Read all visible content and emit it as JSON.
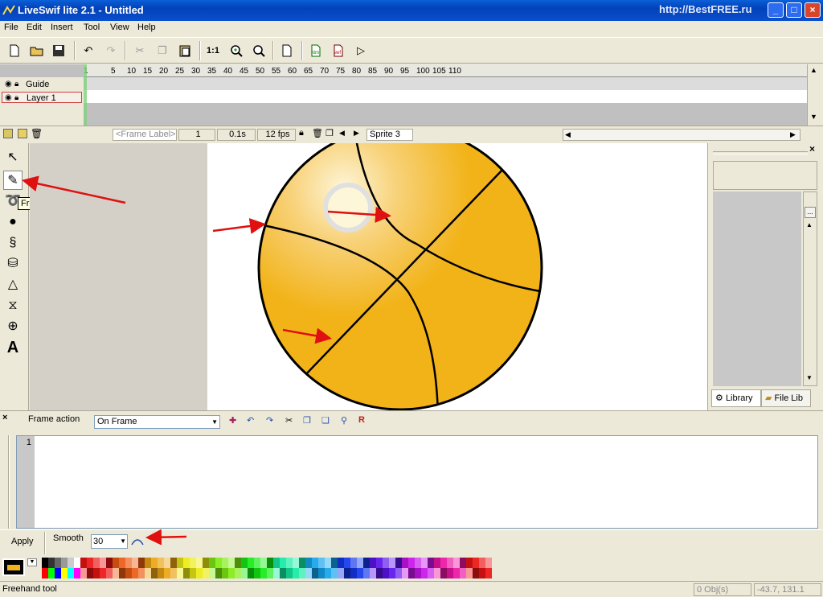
{
  "window": {
    "title": "LiveSwif lite 2.1  - Untitled",
    "watermark": "http://BestFREE.ru",
    "buttons": [
      "_",
      "□",
      "×"
    ]
  },
  "menu": [
    "File",
    "Edit",
    "Insert",
    "Tool",
    "View",
    "Help"
  ],
  "toolbar": {
    "icons": [
      "new-icon",
      "open-icon",
      "save-icon",
      "undo-icon",
      "redo-icon",
      "cut-icon",
      "copy-icon",
      "paste-icon",
      "zoom-1-1",
      "zoom-in-icon",
      "zoom-fit-icon",
      "page-icon",
      "export-html-icon",
      "export-swf-icon",
      "play-icon"
    ],
    "zoom_label": "1:1"
  },
  "timeline": {
    "ticks": [
      "1",
      "5",
      "10",
      "15",
      "20",
      "25",
      "30",
      "35",
      "40",
      "45",
      "50",
      "55",
      "60",
      "65",
      "70",
      "75",
      "80",
      "85",
      "90",
      "95",
      "100",
      "105",
      "110"
    ],
    "layers": [
      {
        "name": "Guide"
      },
      {
        "name": "Layer 1"
      }
    ],
    "frame_label_placeholder": "<Frame Label>",
    "frame_number": "1",
    "time": "0.1s",
    "fps": "12 fps",
    "sprite_tab": "Sprite 3"
  },
  "tools": {
    "items": [
      "arrow-tool",
      "freehand-tool",
      "lasso-tool",
      "oval-tool",
      "curve-tool",
      "paint-bucket-tool",
      "transform-tool",
      "envelope-tool",
      "zoom-tool",
      "text-tool"
    ],
    "text_tool_glyph": "A",
    "tooltip": "Freehand tool"
  },
  "stage": {
    "ball_colors": {
      "fill": "#f2b318",
      "highlight": "#fdf6d8",
      "stroke": "#000000"
    }
  },
  "library": {
    "tabs": [
      "Library",
      "File Lib"
    ],
    "more_button": "..."
  },
  "action": {
    "title": "Frame action",
    "event": "On Frame",
    "line_number": "1"
  },
  "options": {
    "apply_label": "Apply",
    "smooth_label": "Smooth",
    "smooth_value": "30"
  },
  "statusbar": {
    "message": "Freehand tool",
    "objects": "0 Obj(s)",
    "coords": "-43.7, 131.1"
  }
}
